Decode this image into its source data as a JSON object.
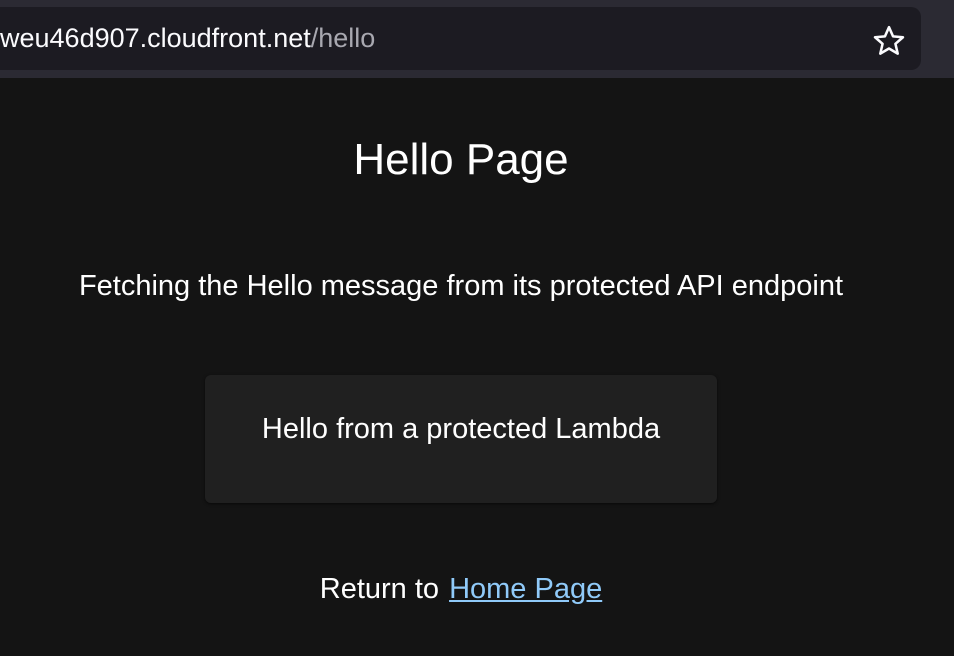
{
  "browser": {
    "url_host": "weu46d907.cloudfront.net",
    "url_path": "/hello",
    "bookmark_icon": "star-icon"
  },
  "page": {
    "title": "Hello Page",
    "subtitle": "Fetching the Hello message from its protected API endpoint",
    "message": "Hello from a protected Lambda",
    "return_prefix": "Return to",
    "home_link": "Home Page"
  },
  "colors": {
    "background": "#141414",
    "card": "#202020",
    "link": "#90caf9",
    "urlbar": "#1c1b22"
  }
}
